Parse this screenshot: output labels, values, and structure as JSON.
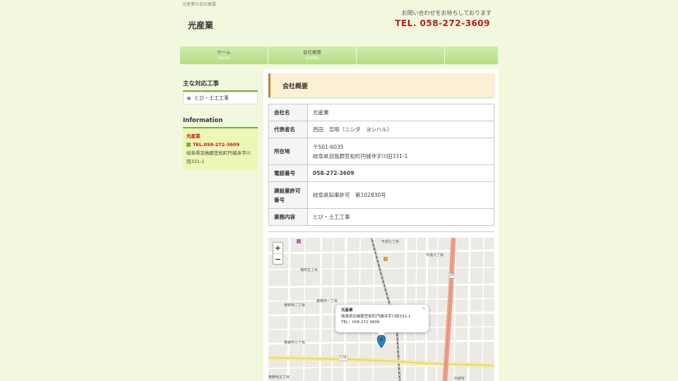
{
  "header": {
    "breadcrumb": "光産業の会社概要",
    "site_name": "光産業",
    "contact_note": "お問い合わせをお待ちしております",
    "tel": "TEL. 058-272-3609"
  },
  "nav": {
    "items": [
      {
        "label": "ホーム",
        "sub": "home"
      },
      {
        "label": "会社概要",
        "sub": "profile"
      }
    ]
  },
  "sidebar": {
    "works_heading": "主な対応工事",
    "works_items": [
      "とび・土工工事"
    ],
    "info_heading": "Information",
    "info_name": "光産業",
    "info_tel": "TEL.058-272-3609",
    "info_address": "岐阜県羽島郡笠松町円城寺字川田331-1"
  },
  "main": {
    "title": "会社概要",
    "table": [
      {
        "label": "会社名",
        "value": "光産業"
      },
      {
        "label": "代表者名",
        "value": "西田　吉晴（ニシダ　ヨシハル）"
      },
      {
        "label": "所在地",
        "value": "〒501-6035",
        "value2": "岐阜県羽島郡笠松町円城寺字川田331-1"
      },
      {
        "label": "電話番号",
        "value": "058-272-3609"
      },
      {
        "label": "建設業許可番号",
        "value": "岐阜県知事許可　第102830号"
      },
      {
        "label": "業務内容",
        "value": "とび・土工工事"
      }
    ]
  },
  "map": {
    "zoom_in": "+",
    "zoom_out": "−",
    "popup_name": "光産業",
    "popup_address": "岐阜県羽島郡笠松町円城寺字川田331-1",
    "popup_tel": "TEL：058-272-3609",
    "popup_close": "×",
    "labels": [
      "平成七丁目",
      "平成六丁目",
      "徳田五丁目",
      "東鋳寺一丁目",
      "東鋳寺二丁目",
      "東鋳寺三丁目",
      "東鋳寺五丁目",
      "円城寺",
      "22",
      "178"
    ]
  },
  "colors": {
    "accent_red": "#c0191d",
    "nav_green": "#b6dd87",
    "info_bg": "#ebf7b4",
    "title_bg": "#fbf0d3"
  }
}
